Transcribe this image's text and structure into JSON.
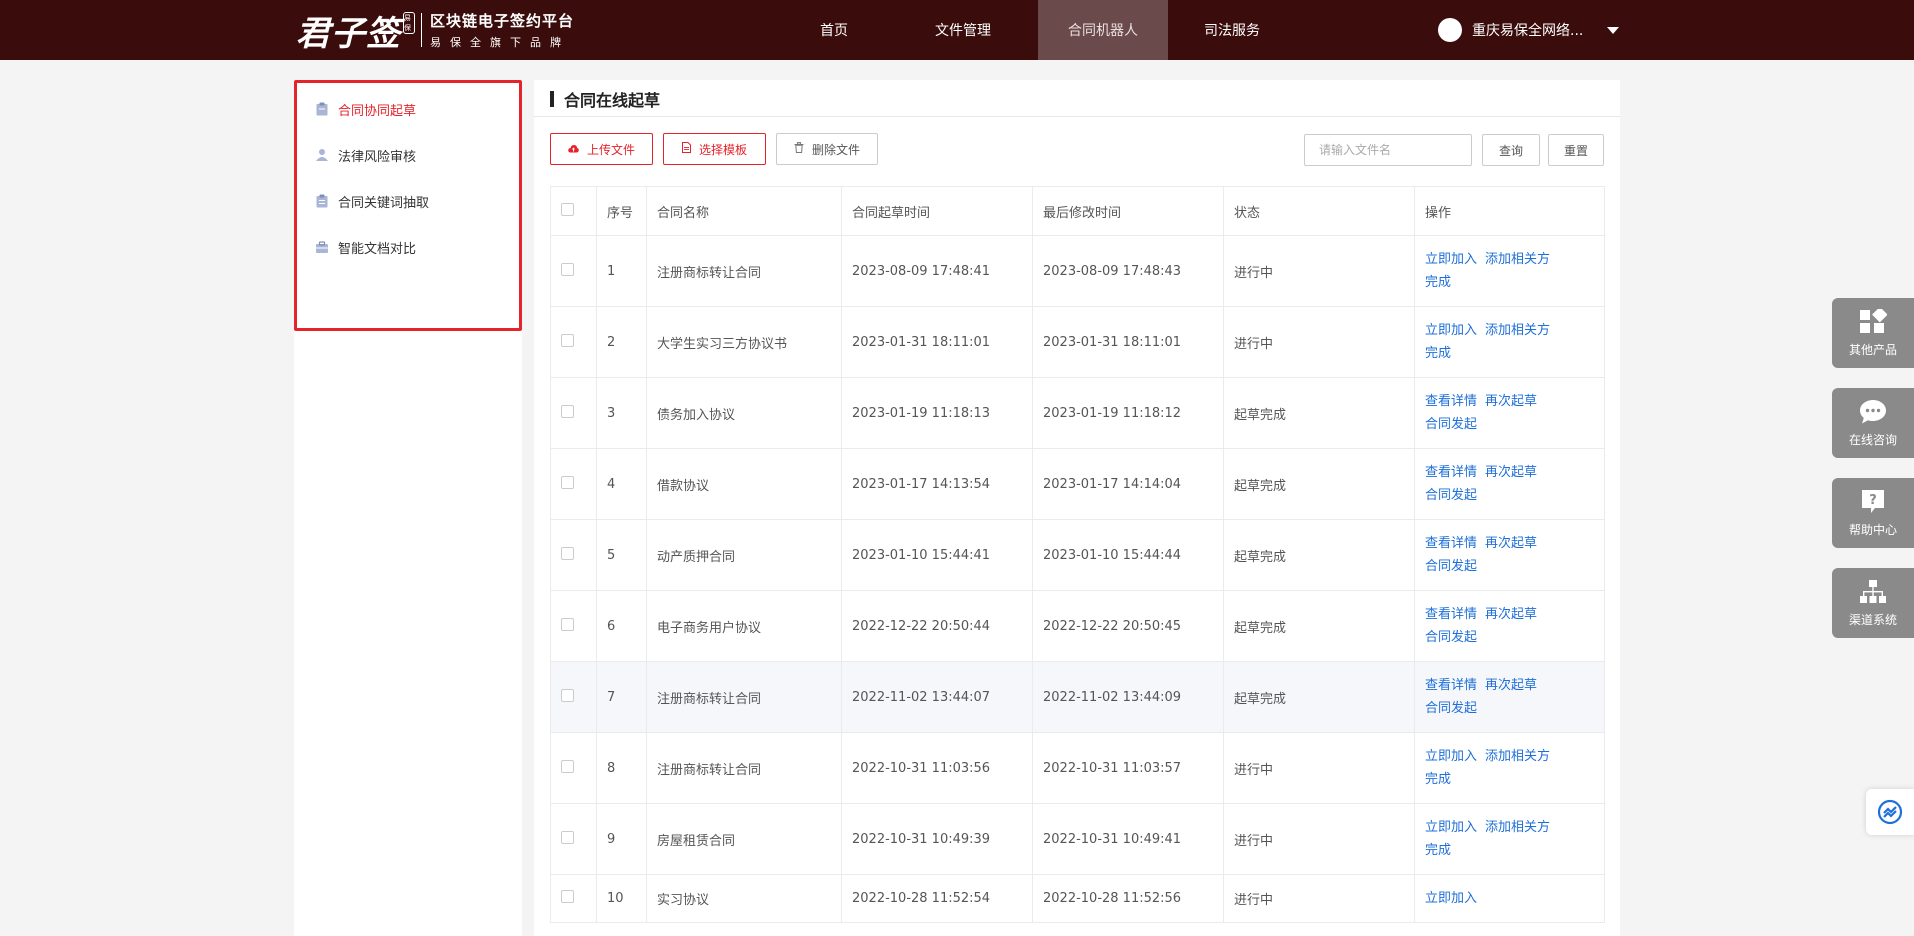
{
  "logo": {
    "mark": "君子签",
    "seal": "易保",
    "line1": "区块链电子签约平台",
    "line2": "易保全旗下品牌"
  },
  "nav": [
    {
      "label": "首页",
      "active": false
    },
    {
      "label": "文件管理",
      "active": false
    },
    {
      "label": "合同机器人",
      "active": true
    },
    {
      "label": "司法服务",
      "active": false
    }
  ],
  "user": {
    "name": "重庆易保全网络..."
  },
  "sidebar": {
    "items": [
      {
        "label": "合同协同起草",
        "active": true
      },
      {
        "label": "法律风险审核",
        "active": false
      },
      {
        "label": "合同关键词抽取",
        "active": false
      },
      {
        "label": "智能文档对比",
        "active": false
      }
    ]
  },
  "panel": {
    "title": "合同在线起草"
  },
  "toolbar": {
    "upload": "上传文件",
    "template": "选择模板",
    "delete": "删除文件",
    "search_placeholder": "请输入文件名",
    "query": "查询",
    "reset": "重置"
  },
  "table": {
    "headers": [
      "序号",
      "合同名称",
      "合同起草时间",
      "最后修改时间",
      "状态",
      "操作"
    ],
    "rows": [
      {
        "no": "1",
        "name": "注册商标转让合同",
        "created": "2023-08-09 17:48:41",
        "modified": "2023-08-09 17:48:43",
        "status": "进行中",
        "ops": [
          "立即加入",
          "添加相关方",
          "完成"
        ]
      },
      {
        "no": "2",
        "name": "大学生实习三方协议书",
        "created": "2023-01-31 18:11:01",
        "modified": "2023-01-31 18:11:01",
        "status": "进行中",
        "ops": [
          "立即加入",
          "添加相关方",
          "完成"
        ]
      },
      {
        "no": "3",
        "name": "债务加入协议",
        "created": "2023-01-19 11:18:13",
        "modified": "2023-01-19 11:18:12",
        "status": "起草完成",
        "ops": [
          "查看详情",
          "再次起草",
          "合同发起"
        ]
      },
      {
        "no": "4",
        "name": "借款协议",
        "created": "2023-01-17 14:13:54",
        "modified": "2023-01-17 14:14:04",
        "status": "起草完成",
        "ops": [
          "查看详情",
          "再次起草",
          "合同发起"
        ]
      },
      {
        "no": "5",
        "name": "动产质押合同",
        "created": "2023-01-10 15:44:41",
        "modified": "2023-01-10 15:44:44",
        "status": "起草完成",
        "ops": [
          "查看详情",
          "再次起草",
          "合同发起"
        ]
      },
      {
        "no": "6",
        "name": "电子商务用户协议",
        "created": "2022-12-22 20:50:44",
        "modified": "2022-12-22 20:50:45",
        "status": "起草完成",
        "ops": [
          "查看详情",
          "再次起草",
          "合同发起"
        ]
      },
      {
        "no": "7",
        "name": "注册商标转让合同",
        "created": "2022-11-02 13:44:07",
        "modified": "2022-11-02 13:44:09",
        "status": "起草完成",
        "ops": [
          "查看详情",
          "再次起草",
          "合同发起"
        ]
      },
      {
        "no": "8",
        "name": "注册商标转让合同",
        "created": "2022-10-31 11:03:56",
        "modified": "2022-10-31 11:03:57",
        "status": "进行中",
        "ops": [
          "立即加入",
          "添加相关方",
          "完成"
        ]
      },
      {
        "no": "9",
        "name": "房屋租赁合同",
        "created": "2022-10-31 10:49:39",
        "modified": "2022-10-31 10:49:41",
        "status": "进行中",
        "ops": [
          "立即加入",
          "添加相关方",
          "完成"
        ]
      },
      {
        "no": "10",
        "name": "实习协议",
        "created": "2022-10-28 11:52:54",
        "modified": "2022-10-28 11:52:56",
        "status": "进行中",
        "ops": [
          "立即加入"
        ]
      }
    ]
  },
  "float": {
    "products": "其他产品",
    "consult": "在线咨询",
    "help": "帮助中心",
    "channel": "渠道系统"
  },
  "colors": {
    "header": "#3a0c0c",
    "accent": "#e5232a",
    "status_doing": "#f39a4d",
    "status_done": "#58b33f",
    "link": "#1e6fd9"
  }
}
